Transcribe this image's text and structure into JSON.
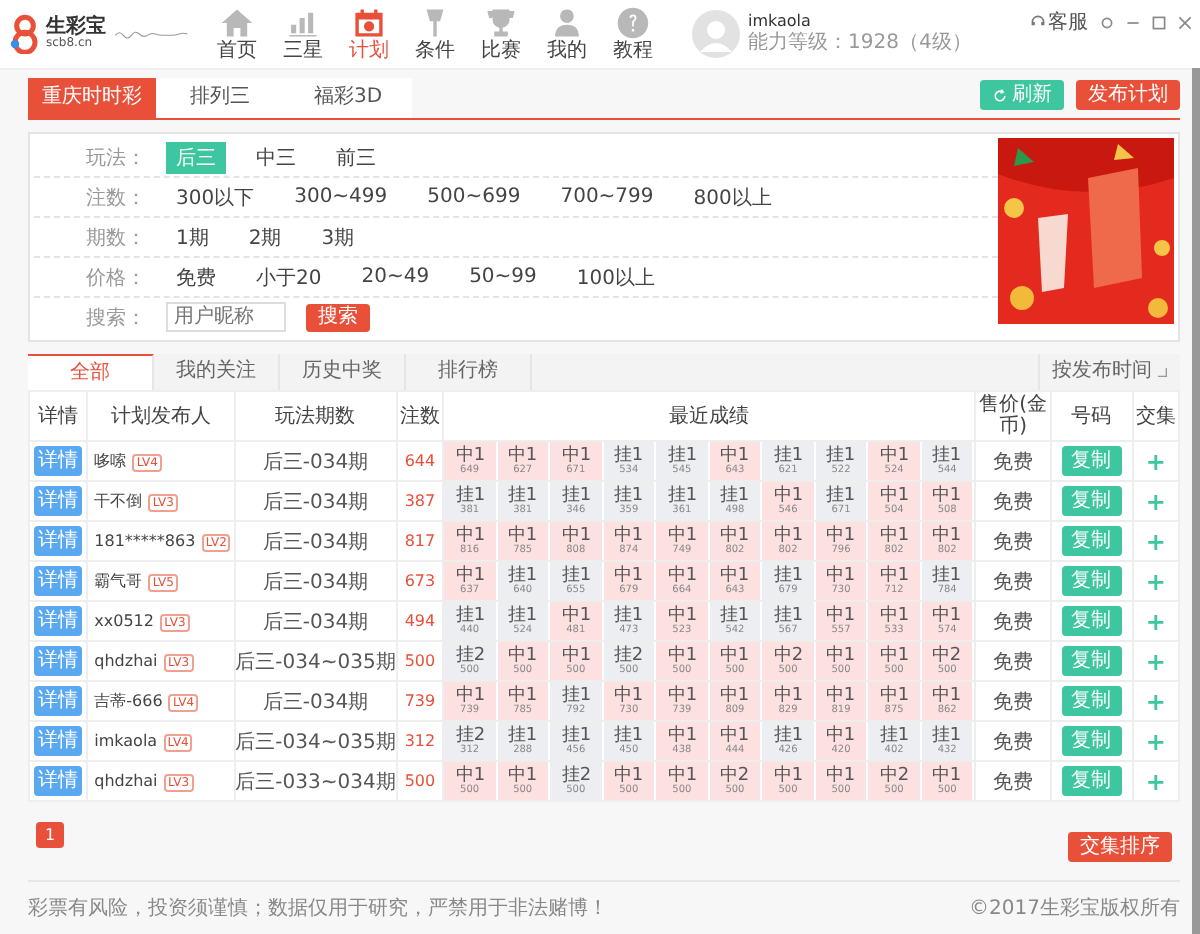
{
  "app": {
    "name": "生彩宝",
    "domain": "scb8.cn"
  },
  "nav": [
    {
      "label": "首页",
      "selected": false
    },
    {
      "label": "三星",
      "selected": false
    },
    {
      "label": "计划",
      "selected": true
    },
    {
      "label": "条件",
      "selected": false
    },
    {
      "label": "比赛",
      "selected": false
    },
    {
      "label": "我的",
      "selected": false
    },
    {
      "label": "教程",
      "selected": false
    }
  ],
  "user": {
    "name": "imkaola",
    "level": "能力等级：1928（4级）"
  },
  "service": "客服",
  "lottery_tabs": [
    {
      "label": "重庆时时彩",
      "selected": true
    },
    {
      "label": "排列三",
      "selected": false
    },
    {
      "label": "福彩3D",
      "selected": false
    }
  ],
  "actions": {
    "refresh": "刷新",
    "publish": "发布计划"
  },
  "filters": [
    {
      "label": "玩法：",
      "options": [
        {
          "label": "后三",
          "selected": true
        },
        {
          "label": "中三",
          "selected": false
        },
        {
          "label": "前三",
          "selected": false
        }
      ]
    },
    {
      "label": "注数：",
      "options": [
        {
          "label": "300以下",
          "selected": false
        },
        {
          "label": "300~499",
          "selected": false
        },
        {
          "label": "500~699",
          "selected": false
        },
        {
          "label": "700~799",
          "selected": false
        },
        {
          "label": "800以上",
          "selected": false
        }
      ]
    },
    {
      "label": "期数：",
      "options": [
        {
          "label": "1期",
          "selected": false
        },
        {
          "label": "2期",
          "selected": false
        },
        {
          "label": "3期",
          "selected": false
        }
      ]
    },
    {
      "label": "价格：",
      "options": [
        {
          "label": "免费",
          "selected": false
        },
        {
          "label": "小于20",
          "selected": false
        },
        {
          "label": "20~49",
          "selected": false
        },
        {
          "label": "50~99",
          "selected": false
        },
        {
          "label": "100以上",
          "selected": false
        }
      ]
    }
  ],
  "search": {
    "label": "搜索：",
    "placeholder": "用户昵称",
    "button": "搜索"
  },
  "table_tabs": [
    {
      "label": "全部",
      "selected": true
    },
    {
      "label": "我的关注",
      "selected": false
    },
    {
      "label": "历史中奖",
      "selected": false
    },
    {
      "label": "排行榜",
      "selected": false
    }
  ],
  "sort": "按发布时间",
  "columns": [
    "详情",
    "计划发布人",
    "玩法期数",
    "注数",
    "最近成绩",
    "售价(金币)",
    "号码",
    "交集"
  ],
  "rows": [
    {
      "detail": "详情",
      "name": "哆嗦",
      "lv": "LV4",
      "period": "后三-034期",
      "count": "644",
      "results": [
        {
          "label": "中1",
          "value": "649",
          "kind": "hit"
        },
        {
          "label": "中1",
          "value": "627",
          "kind": "hit"
        },
        {
          "label": "中1",
          "value": "671",
          "kind": "hit"
        },
        {
          "label": "挂1",
          "value": "534",
          "kind": "miss"
        },
        {
          "label": "挂1",
          "value": "545",
          "kind": "miss"
        },
        {
          "label": "中1",
          "value": "643",
          "kind": "hit"
        },
        {
          "label": "挂1",
          "value": "621",
          "kind": "miss"
        },
        {
          "label": "挂1",
          "value": "522",
          "kind": "miss"
        },
        {
          "label": "中1",
          "value": "524",
          "kind": "hit"
        },
        {
          "label": "挂1",
          "value": "544",
          "kind": "miss"
        }
      ],
      "price": "免费",
      "copy": "复制",
      "add": "+"
    },
    {
      "detail": "详情",
      "name": "干不倒",
      "lv": "LV3",
      "period": "后三-034期",
      "count": "387",
      "results": [
        {
          "label": "挂1",
          "value": "381",
          "kind": "miss"
        },
        {
          "label": "挂1",
          "value": "381",
          "kind": "miss"
        },
        {
          "label": "挂1",
          "value": "346",
          "kind": "miss"
        },
        {
          "label": "挂1",
          "value": "359",
          "kind": "miss"
        },
        {
          "label": "挂1",
          "value": "361",
          "kind": "miss"
        },
        {
          "label": "挂1",
          "value": "498",
          "kind": "miss"
        },
        {
          "label": "中1",
          "value": "546",
          "kind": "hit"
        },
        {
          "label": "挂1",
          "value": "671",
          "kind": "miss"
        },
        {
          "label": "中1",
          "value": "504",
          "kind": "hit"
        },
        {
          "label": "中1",
          "value": "508",
          "kind": "hit"
        }
      ],
      "price": "免费",
      "copy": "复制",
      "add": "+"
    },
    {
      "detail": "详情",
      "name": "181*****863",
      "lv": "LV2",
      "period": "后三-034期",
      "count": "817",
      "results": [
        {
          "label": "中1",
          "value": "816",
          "kind": "hit"
        },
        {
          "label": "中1",
          "value": "785",
          "kind": "hit"
        },
        {
          "label": "中1",
          "value": "808",
          "kind": "hit"
        },
        {
          "label": "中1",
          "value": "874",
          "kind": "hit"
        },
        {
          "label": "中1",
          "value": "749",
          "kind": "hit"
        },
        {
          "label": "中1",
          "value": "802",
          "kind": "hit"
        },
        {
          "label": "中1",
          "value": "802",
          "kind": "hit"
        },
        {
          "label": "中1",
          "value": "796",
          "kind": "hit"
        },
        {
          "label": "中1",
          "value": "802",
          "kind": "hit"
        },
        {
          "label": "中1",
          "value": "802",
          "kind": "hit"
        }
      ],
      "price": "免费",
      "copy": "复制",
      "add": "+"
    },
    {
      "detail": "详情",
      "name": "霸气哥",
      "lv": "LV5",
      "period": "后三-034期",
      "count": "673",
      "results": [
        {
          "label": "中1",
          "value": "637",
          "kind": "hit"
        },
        {
          "label": "挂1",
          "value": "640",
          "kind": "miss"
        },
        {
          "label": "挂1",
          "value": "655",
          "kind": "miss"
        },
        {
          "label": "中1",
          "value": "679",
          "kind": "hit"
        },
        {
          "label": "中1",
          "value": "664",
          "kind": "hit"
        },
        {
          "label": "中1",
          "value": "643",
          "kind": "hit"
        },
        {
          "label": "挂1",
          "value": "679",
          "kind": "miss"
        },
        {
          "label": "中1",
          "value": "730",
          "kind": "hit"
        },
        {
          "label": "中1",
          "value": "712",
          "kind": "hit"
        },
        {
          "label": "挂1",
          "value": "784",
          "kind": "miss"
        }
      ],
      "price": "免费",
      "copy": "复制",
      "add": "+"
    },
    {
      "detail": "详情",
      "name": "xx0512",
      "lv": "LV3",
      "period": "后三-034期",
      "count": "494",
      "results": [
        {
          "label": "挂1",
          "value": "440",
          "kind": "miss"
        },
        {
          "label": "挂1",
          "value": "524",
          "kind": "miss"
        },
        {
          "label": "中1",
          "value": "481",
          "kind": "hit"
        },
        {
          "label": "挂1",
          "value": "473",
          "kind": "miss"
        },
        {
          "label": "中1",
          "value": "523",
          "kind": "hit"
        },
        {
          "label": "挂1",
          "value": "542",
          "kind": "miss"
        },
        {
          "label": "挂1",
          "value": "567",
          "kind": "miss"
        },
        {
          "label": "中1",
          "value": "557",
          "kind": "hit"
        },
        {
          "label": "中1",
          "value": "533",
          "kind": "hit"
        },
        {
          "label": "中1",
          "value": "574",
          "kind": "hit"
        }
      ],
      "price": "免费",
      "copy": "复制",
      "add": "+"
    },
    {
      "detail": "详情",
      "name": "qhdzhai",
      "lv": "LV3",
      "period": "后三-034~035期",
      "count": "500",
      "results": [
        {
          "label": "挂2",
          "value": "500",
          "kind": "miss"
        },
        {
          "label": "中1",
          "value": "500",
          "kind": "hit"
        },
        {
          "label": "中1",
          "value": "500",
          "kind": "hit"
        },
        {
          "label": "挂2",
          "value": "500",
          "kind": "miss"
        },
        {
          "label": "中1",
          "value": "500",
          "kind": "hit"
        },
        {
          "label": "中1",
          "value": "500",
          "kind": "hit"
        },
        {
          "label": "中2",
          "value": "500",
          "kind": "hit"
        },
        {
          "label": "中1",
          "value": "500",
          "kind": "hit"
        },
        {
          "label": "中1",
          "value": "500",
          "kind": "hit"
        },
        {
          "label": "中2",
          "value": "500",
          "kind": "hit"
        }
      ],
      "price": "免费",
      "copy": "复制",
      "add": "+"
    },
    {
      "detail": "详情",
      "name": "吉蒂-666",
      "lv": "LV4",
      "period": "后三-034期",
      "count": "739",
      "results": [
        {
          "label": "中1",
          "value": "739",
          "kind": "hit"
        },
        {
          "label": "中1",
          "value": "785",
          "kind": "hit"
        },
        {
          "label": "挂1",
          "value": "792",
          "kind": "miss"
        },
        {
          "label": "中1",
          "value": "730",
          "kind": "hit"
        },
        {
          "label": "中1",
          "value": "739",
          "kind": "hit"
        },
        {
          "label": "中1",
          "value": "809",
          "kind": "hit"
        },
        {
          "label": "中1",
          "value": "829",
          "kind": "hit"
        },
        {
          "label": "中1",
          "value": "819",
          "kind": "hit"
        },
        {
          "label": "中1",
          "value": "875",
          "kind": "hit"
        },
        {
          "label": "中1",
          "value": "862",
          "kind": "hit"
        }
      ],
      "price": "免费",
      "copy": "复制",
      "add": "+"
    },
    {
      "detail": "详情",
      "name": "imkaola",
      "lv": "LV4",
      "period": "后三-034~035期",
      "count": "312",
      "results": [
        {
          "label": "挂2",
          "value": "312",
          "kind": "miss"
        },
        {
          "label": "挂1",
          "value": "288",
          "kind": "miss"
        },
        {
          "label": "挂1",
          "value": "456",
          "kind": "miss"
        },
        {
          "label": "挂1",
          "value": "450",
          "kind": "miss"
        },
        {
          "label": "中1",
          "value": "438",
          "kind": "hit"
        },
        {
          "label": "中1",
          "value": "444",
          "kind": "hit"
        },
        {
          "label": "挂1",
          "value": "426",
          "kind": "miss"
        },
        {
          "label": "中1",
          "value": "420",
          "kind": "hit"
        },
        {
          "label": "挂1",
          "value": "402",
          "kind": "miss"
        },
        {
          "label": "挂1",
          "value": "432",
          "kind": "miss"
        }
      ],
      "price": "免费",
      "copy": "复制",
      "add": "+"
    },
    {
      "detail": "详情",
      "name": "qhdzhai",
      "lv": "LV3",
      "period": "后三-033~034期",
      "count": "500",
      "results": [
        {
          "label": "中1",
          "value": "500",
          "kind": "hit"
        },
        {
          "label": "中1",
          "value": "500",
          "kind": "hit"
        },
        {
          "label": "挂2",
          "value": "500",
          "kind": "miss"
        },
        {
          "label": "中1",
          "value": "500",
          "kind": "hit"
        },
        {
          "label": "中1",
          "value": "500",
          "kind": "hit"
        },
        {
          "label": "中2",
          "value": "500",
          "kind": "hit"
        },
        {
          "label": "中1",
          "value": "500",
          "kind": "hit"
        },
        {
          "label": "中1",
          "value": "500",
          "kind": "hit"
        },
        {
          "label": "中2",
          "value": "500",
          "kind": "hit"
        },
        {
          "label": "中1",
          "value": "500",
          "kind": "hit"
        }
      ],
      "price": "免费",
      "copy": "复制",
      "add": "+"
    }
  ],
  "pages": [
    {
      "label": "1",
      "selected": true
    }
  ],
  "sort_button": "交集排序",
  "footer": {
    "disclaimer": "彩票有风险，投资须谨慎；数据仅用于研究，严禁用于非法赌博！",
    "copyright": "©2017生彩宝版权所有"
  }
}
